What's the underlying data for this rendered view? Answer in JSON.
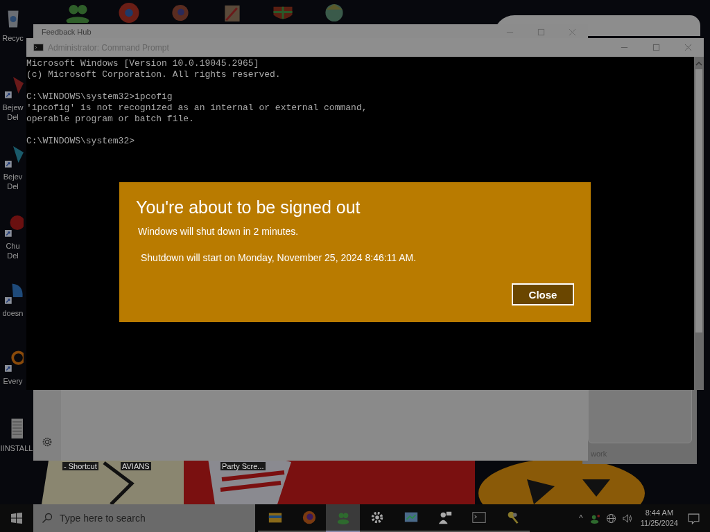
{
  "desktop_icons": [
    {
      "kind": "bin",
      "lines": [
        "Recyc"
      ]
    },
    {
      "kind": "game",
      "lines": [
        "Bejew",
        "Del"
      ]
    },
    {
      "kind": "gem",
      "lines": [
        "Bejev",
        "Del"
      ]
    },
    {
      "kind": "ball",
      "lines": [
        "Chu",
        "Del"
      ]
    },
    {
      "kind": "bird",
      "lines": [
        "doesn"
      ]
    },
    {
      "kind": "ring",
      "lines": [
        "Every"
      ]
    },
    {
      "kind": "doc",
      "lines": [
        "IINSTALL"
      ]
    }
  ],
  "wallpaper_labels": [
    "- Shortcut",
    "AVIANS",
    "Party Scre..."
  ],
  "back_window": {
    "text": "work"
  },
  "feedback_window": {
    "title": "Feedback Hub"
  },
  "cmd_window": {
    "title": "Administrator: Command Prompt",
    "blocks": [
      [
        "Microsoft Windows [Version 10.0.19045.2965]",
        "(c) Microsoft Corporation. All rights reserved."
      ],
      [
        "C:\\WINDOWS\\system32>ipcofig",
        "'ipcofig' is not recognized as an internal or external command,",
        "operable program or batch file."
      ],
      [
        "C:\\WINDOWS\\system32>"
      ]
    ]
  },
  "dialog": {
    "title": "You're about to be signed out",
    "message": "Windows will shut down in 2 minutes.",
    "detail": "Shutdown will start on Monday, November 25, 2024 8:46:11 AM.",
    "button": "Close"
  },
  "taskbar": {
    "search_placeholder": "Type here to search",
    "apps": [
      {
        "kind": "folder",
        "selected": false
      },
      {
        "kind": "browser",
        "selected": false
      },
      {
        "kind": "people",
        "selected": true
      },
      {
        "kind": "gear",
        "selected": false
      },
      {
        "kind": "panel",
        "selected": false
      },
      {
        "kind": "person",
        "selected": false
      },
      {
        "kind": "terminal",
        "selected": false
      },
      {
        "kind": "keys",
        "selected": false
      }
    ],
    "tray_caret": "^",
    "time": "8:44 AM",
    "date": "11/25/2024"
  }
}
